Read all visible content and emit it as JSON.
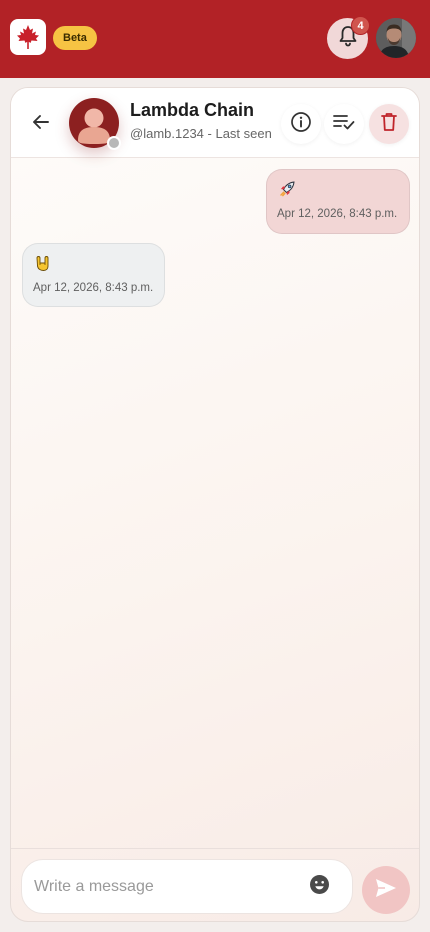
{
  "app": {
    "beta_label": "Beta",
    "notifications_count": "4",
    "icons": {
      "logo": "maple-leaf-icon",
      "notifications": "bell-icon",
      "user": "user-avatar"
    },
    "colors": {
      "brand": "#b22226",
      "beta_badge": "#f6c343",
      "outgoing_bubble": "#f2d6d5",
      "incoming_bubble": "#eef0f1"
    }
  },
  "chat": {
    "contact": {
      "name": "Lambda Chain",
      "subtitle": "@lamb.1234 - Last seen"
    },
    "header_icons": [
      "arrow-left-icon",
      "info-icon",
      "playlist-check-icon",
      "trash-icon"
    ],
    "messages": [
      {
        "direction": "outgoing",
        "emoji": "🚀",
        "time": "Apr 12, 2026, 8:43 p.m."
      },
      {
        "direction": "incoming",
        "emoji": "🤘",
        "time": "Apr 12, 2026, 8:43 p.m."
      }
    ]
  },
  "composer": {
    "placeholder": "Write a message",
    "icons": [
      "emoji-icon",
      "send-icon"
    ]
  }
}
